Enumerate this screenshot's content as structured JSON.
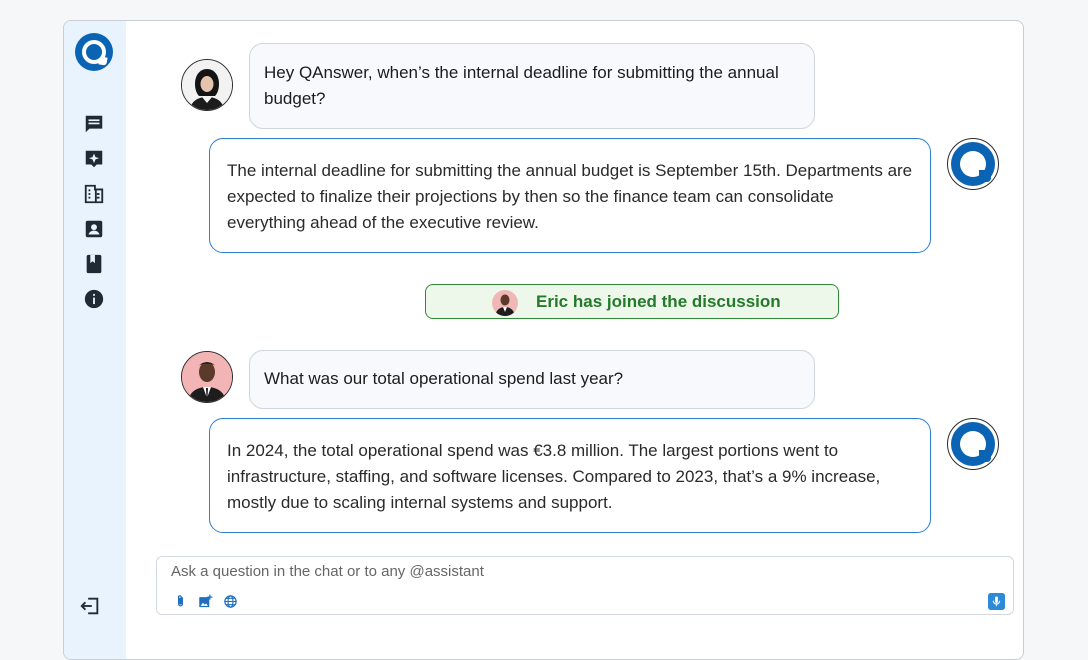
{
  "app": {
    "logo_icon": "qanswer-logo-icon",
    "accent": "#0b63b3"
  },
  "sidebar": {
    "items": [
      {
        "icon": "chat-icon"
      },
      {
        "icon": "sparkle-icon"
      },
      {
        "icon": "building-icon"
      },
      {
        "icon": "contact-icon"
      },
      {
        "icon": "book-icon"
      },
      {
        "icon": "info-icon"
      }
    ],
    "logout_icon": "logout-icon"
  },
  "messages": [
    {
      "role": "user",
      "avatar": "woman-avatar",
      "text": "Hey QAnswer, when’s the internal deadline for submitting the annual budget?"
    },
    {
      "role": "assistant",
      "text": "The internal deadline for submitting the annual budget is September 15th. Departments are expected to finalize their projections by then so the finance team can consolidate everything ahead of the executive review."
    },
    {
      "role": "system",
      "text": "Eric has joined the discussion"
    },
    {
      "role": "user",
      "avatar": "man-avatar",
      "text": "What was our total operational spend last year?"
    },
    {
      "role": "assistant",
      "text": "In 2024, the total operational spend was €3.8 million. The largest portions went to infrastructure, staffing, and software licenses. Compared to 2023, that’s a 9% increase, mostly due to scaling internal systems and support."
    }
  ],
  "composer": {
    "placeholder": "Ask a question in the chat or to any @assistant",
    "value": "",
    "tools": [
      "paperclip-icon",
      "image-add-icon",
      "globe-icon"
    ],
    "mic_icon": "microphone-icon"
  },
  "colors": {
    "join_green": "#247a2b",
    "bot_border": "#2f7fd0",
    "sidebar_bg": "#e8f3fd"
  }
}
